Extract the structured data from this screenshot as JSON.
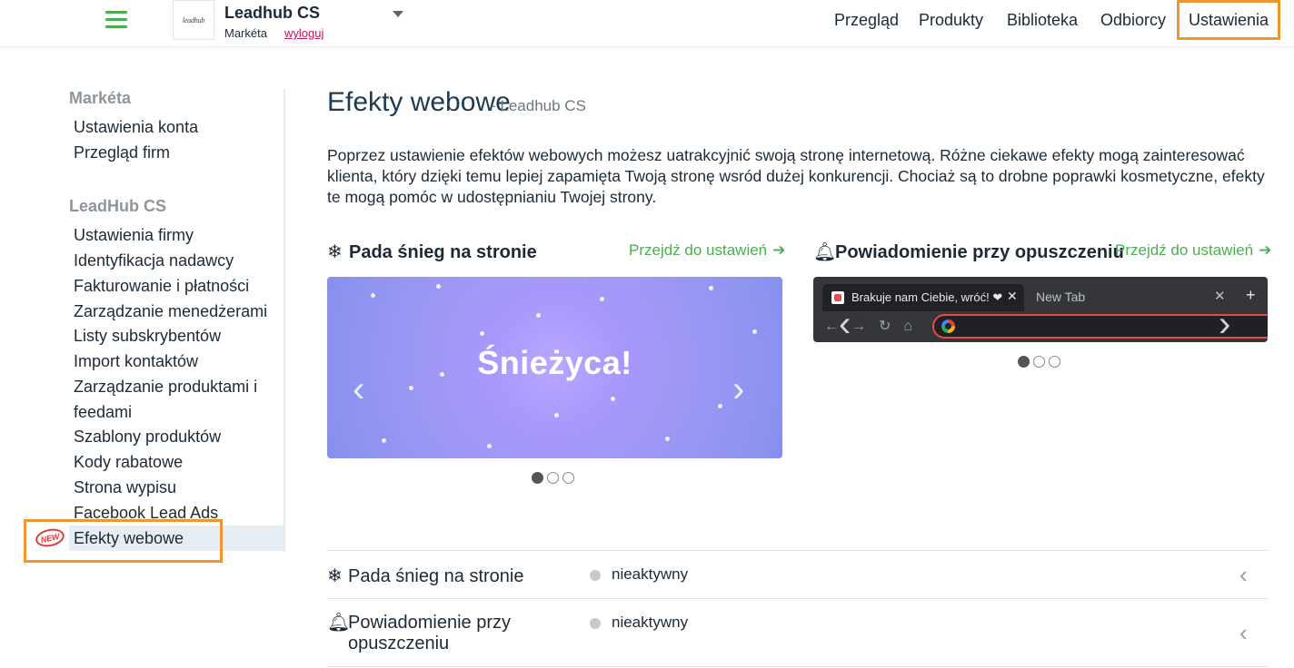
{
  "header": {
    "logo_text": "leadhub",
    "company": "Leadhub CS",
    "user": "Markéta",
    "logout": "wyloguj",
    "nav": [
      "Przegląd",
      "Produkty",
      "Biblioteka",
      "Odbiorcy",
      "Ustawienia"
    ],
    "active_nav": "Ustawienia"
  },
  "sidebar": {
    "group1_title": "Markéta",
    "group1_items": [
      "Ustawienia konta",
      "Przegląd firm"
    ],
    "group2_title": "LeadHub CS",
    "group2_items": [
      "Ustawienia firmy",
      "Identyfikacja nadawcy",
      "Fakturowanie i płatności",
      "Zarządzanie menedżerami",
      "Listy subskrybentów",
      "Import kontaktów",
      "Zarządzanie produktami i",
      "feedami",
      "Szablony produktów",
      "Kody rabatowe",
      "Strona wypisu",
      "Facebook Lead Ads",
      "Efekty webowe"
    ],
    "new_badge": "NEW"
  },
  "main": {
    "title": "Efekty webowe",
    "subtitle": "- Leadhub CS",
    "description": "Poprzez ustawienie efektów webowych możesz uatrakcyjnić swoją stronę internetową. Różne ciekawe efekty mogą zainteresować klienta, który dzięki temu lepiej zapamięta Twoją stronę wsród dużej konkurencji. Chociaż są to drobne poprawki kosmetyczne, efekty te mogą pomóc w udostępnianiu Twojej strony.",
    "cards": [
      {
        "title": "Pada śnieg na stronie",
        "icon": "snowflake-icon",
        "link": "Przejdź do ustawień",
        "preview_text": "Śnieżyca!",
        "active_slide": 0,
        "slides": 3
      },
      {
        "title": "Powiadomienie przy opuszczeniu",
        "icon": "bell-icon",
        "link": "Przejdź do ustawień",
        "tab_text": "Brakuje nam Ciebie, wróć! ❤",
        "new_tab": "New Tab",
        "active_slide": 0,
        "slides": 3
      }
    ],
    "effects": [
      {
        "name": "Pada śnieg na stronie",
        "icon": "snowflake-icon",
        "status": "nieaktywny"
      },
      {
        "name_line1": "Powiadomienie przy",
        "name_line2": "opuszczeniu",
        "icon": "bell-icon",
        "status": "nieaktywny"
      }
    ]
  },
  "colors": {
    "accent_green": "#4cae4f",
    "highlight_orange": "#f0962e",
    "logout_pink": "#c2185b"
  }
}
